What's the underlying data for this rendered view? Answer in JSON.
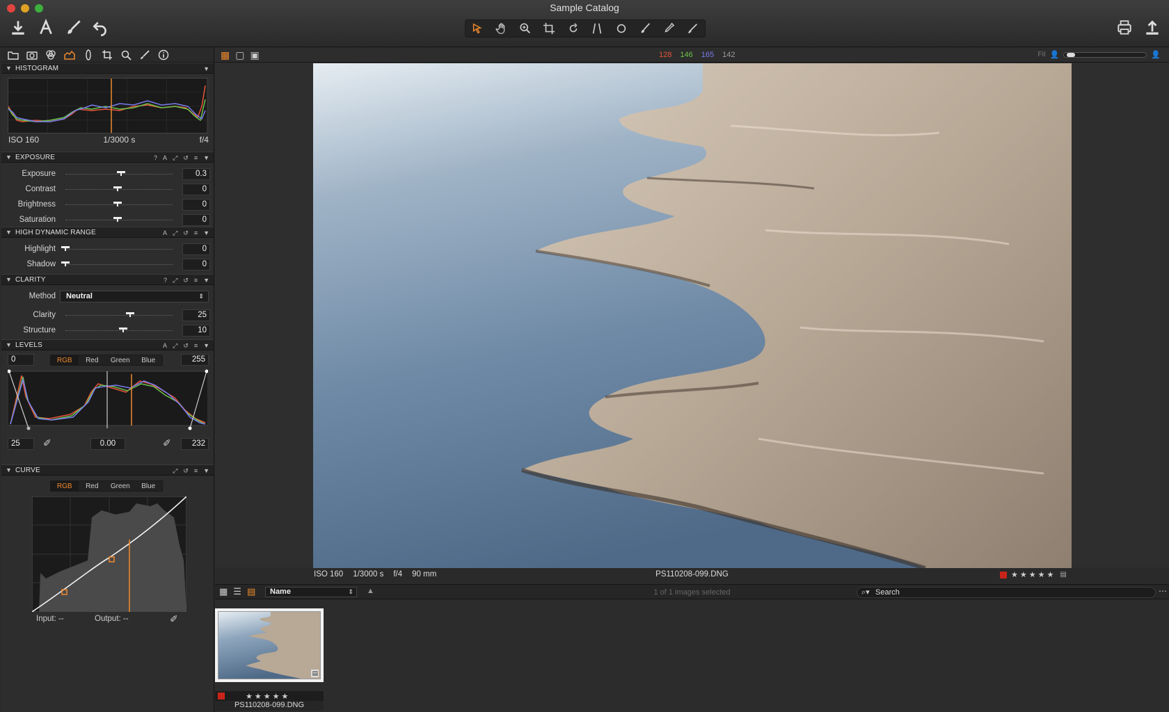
{
  "window": {
    "title": "Sample Catalog"
  },
  "toolbar": {
    "left_icons": [
      "import-icon",
      "text-icon",
      "brush-icon",
      "undo-icon"
    ],
    "tools": [
      "select-arrow-icon",
      "hand-pan-icon",
      "zoom-icon",
      "crop-icon",
      "rotate-icon",
      "keystone-icon",
      "spot-icon",
      "brush-icon",
      "eyedropper-icon",
      "picker-icon"
    ],
    "right_icons": [
      "print-icon",
      "export-icon"
    ]
  },
  "tool_tabs": [
    "library-icon",
    "capture-icon",
    "color-icon",
    "exposure-icon",
    "lens-icon",
    "crop-icon",
    "details-icon",
    "adjustments-icon",
    "metadata-icon"
  ],
  "histogram": {
    "title": "HISTOGRAM",
    "iso": "ISO 160",
    "shutter": "1/3000 s",
    "aperture": "f/4"
  },
  "exposure": {
    "title": "EXPOSURE",
    "ctrls": [
      "?",
      "A"
    ],
    "sliders": [
      {
        "label": "Exposure",
        "value": "0.3",
        "pos": 0.53
      },
      {
        "label": "Contrast",
        "value": "0",
        "pos": 0.5
      },
      {
        "label": "Brightness",
        "value": "0",
        "pos": 0.5
      },
      {
        "label": "Saturation",
        "value": "0",
        "pos": 0.5
      }
    ]
  },
  "hdr": {
    "title": "HIGH DYNAMIC RANGE",
    "ctrls": [
      "A"
    ],
    "sliders": [
      {
        "label": "Highlight",
        "value": "0",
        "pos": 0.0
      },
      {
        "label": "Shadow",
        "value": "0",
        "pos": 0.0
      }
    ]
  },
  "clarity": {
    "title": "CLARITY",
    "ctrls": [
      "?"
    ],
    "method_label": "Method",
    "method_value": "Neutral",
    "sliders": [
      {
        "label": "Clarity",
        "value": "25",
        "pos": 0.62
      },
      {
        "label": "Structure",
        "value": "10",
        "pos": 0.55
      }
    ]
  },
  "levels": {
    "title": "LEVELS",
    "ctrls": [
      "A"
    ],
    "input_low": "0",
    "input_high": "255",
    "channels": [
      "RGB",
      "Red",
      "Green",
      "Blue"
    ],
    "active_channel": "RGB",
    "out_low": "25",
    "mid": "0.00",
    "out_high": "232"
  },
  "curve": {
    "title": "CURVE",
    "channels": [
      "RGB",
      "Red",
      "Green",
      "Blue"
    ],
    "active_channel": "RGB",
    "input_label": "Input:",
    "input_value": "--",
    "output_label": "Output:",
    "output_value": "--"
  },
  "viewer": {
    "rgb_r": "128",
    "rgb_g": "146",
    "rgb_b": "165",
    "rgb_l": "142",
    "fit_label": "Fit",
    "colors": {
      "r": "#e8533a",
      "g": "#6cc24a",
      "b": "#7a7cf0",
      "l": "#9a9a9a",
      "accent": "#f08a2c"
    }
  },
  "status": {
    "iso": "ISO 160",
    "shutter": "1/3000 s",
    "aperture": "f/4",
    "focal": "90 mm",
    "filename": "PS110208-099.DNG",
    "stars": "★★★★★"
  },
  "browser": {
    "sort_label": "Name",
    "selection_text": "1 of 1 images selected",
    "search_placeholder": "Search",
    "thumb_name": "PS110208-099.DNG",
    "thumb_stars": "★★★★★"
  }
}
